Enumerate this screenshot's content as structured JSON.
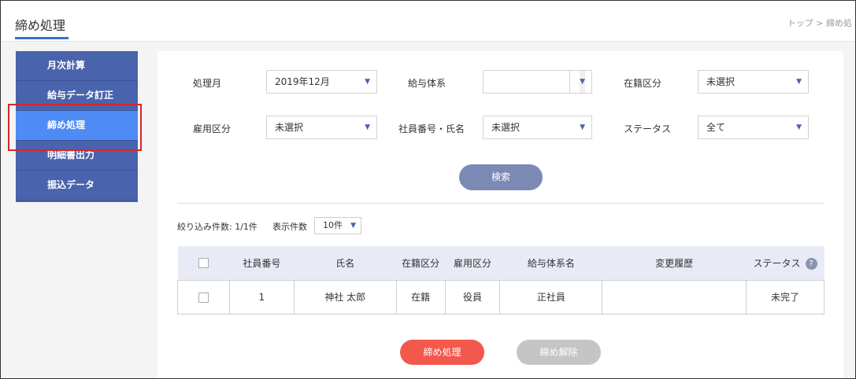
{
  "header": {
    "title": "締め処理",
    "breadcrumb": "トップ > 締め処"
  },
  "sidebar": {
    "items": [
      {
        "label": "月次計算"
      },
      {
        "label": "給与データ訂正"
      },
      {
        "label": "締め処理"
      },
      {
        "label": "明細書出力"
      },
      {
        "label": "振込データ"
      }
    ],
    "active_index": 2
  },
  "filters": {
    "month": {
      "label": "処理月",
      "value": "2019年12月"
    },
    "pay_system": {
      "label": "給与体系",
      "value": ""
    },
    "enrollment": {
      "label": "在籍区分",
      "value": "未選択"
    },
    "employment": {
      "label": "雇用区分",
      "value": "未選択"
    },
    "employee": {
      "label": "社員番号・氏名",
      "value": "未選択"
    },
    "status": {
      "label": "ステータス",
      "value": "全て"
    }
  },
  "search_button": "検索",
  "results": {
    "count_text": "絞り込み件数: 1/1件",
    "per_page_label": "表示件数",
    "per_page_value": "10件"
  },
  "table": {
    "headers": {
      "employee_no": "社員番号",
      "name": "氏名",
      "enrollment": "在籍区分",
      "employment": "雇用区分",
      "pay_system": "給与体系名",
      "history": "変更履歴",
      "status": "ステータス",
      "help": "?"
    },
    "rows": [
      {
        "employee_no": "1",
        "name": "神社 太郎",
        "enrollment": "在籍",
        "employment": "役員",
        "pay_system": "正社員",
        "history": "",
        "status": "未完了"
      }
    ]
  },
  "actions": {
    "close": "締め処理",
    "release": "締め解除"
  },
  "colors": {
    "sidebar": "#4a63ad",
    "active": "#4e8bf5",
    "highlight": "#d9262b",
    "close_button": "#f2584c",
    "release_button": "#c5c5c5",
    "search_button": "#7c89b5"
  },
  "icons": {
    "dropdown": "triangle-down",
    "help": "question-circle"
  }
}
